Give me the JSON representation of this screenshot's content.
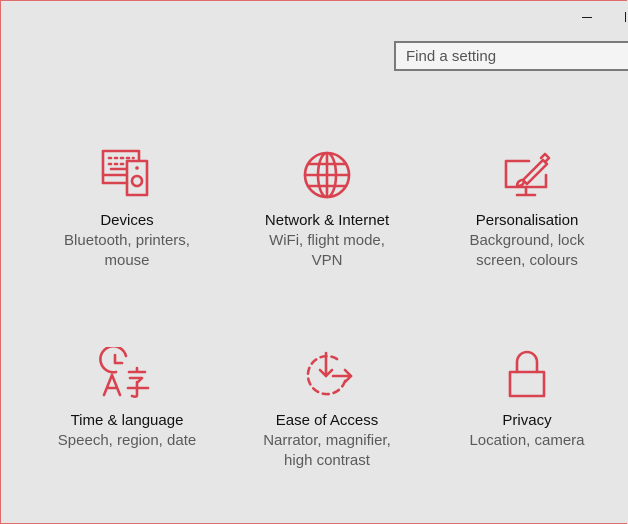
{
  "window": {
    "controls": {
      "minimize": "minimize-icon"
    }
  },
  "search": {
    "placeholder": "Find a setting"
  },
  "colors": {
    "accent": "#d9434f",
    "background": "#e6e6e6"
  },
  "categories": [
    {
      "icon": "devices-icon",
      "title": "Devices",
      "description": "Bluetooth, printers, mouse"
    },
    {
      "icon": "globe-icon",
      "title": "Network & Internet",
      "description": "WiFi, flight mode, VPN"
    },
    {
      "icon": "personalisation-icon",
      "title": "Personalisation",
      "description": "Background, lock screen, colours"
    },
    {
      "icon": "time-language-icon",
      "title": "Time & language",
      "description": "Speech, region, date"
    },
    {
      "icon": "ease-of-access-icon",
      "title": "Ease of Access",
      "description": "Narrator, magnifier, high contrast"
    },
    {
      "icon": "lock-icon",
      "title": "Privacy",
      "description": "Location, camera"
    }
  ]
}
